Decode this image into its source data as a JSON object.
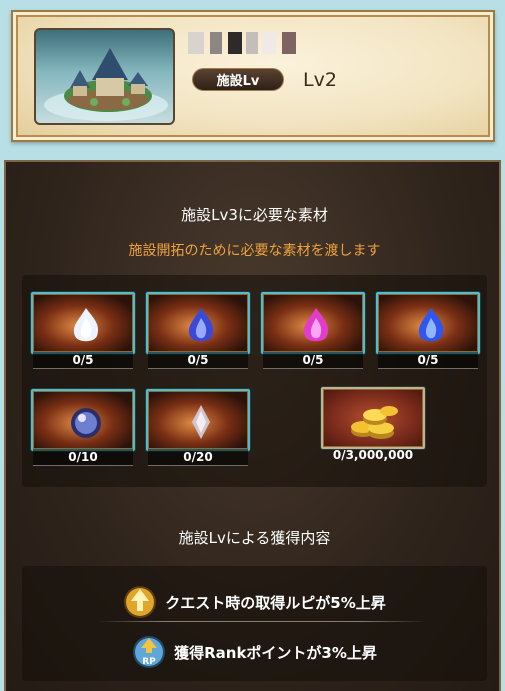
{
  "facility": {
    "level_badge": "施設Lv",
    "level_value": "Lv2",
    "thumbnail_icon": "island-facility-icon"
  },
  "requirements": {
    "title": "施設Lv3に必要な素材",
    "subtitle": "施設開拓のために必要な素材を渡します",
    "items": [
      {
        "icon": "white-flame-icon",
        "count": "0/5",
        "color": "#e8f2ff"
      },
      {
        "icon": "blue-flame-icon",
        "count": "0/5",
        "color": "#3a49d8"
      },
      {
        "icon": "pink-flame-icon",
        "count": "0/5",
        "color": "#e23ccb"
      },
      {
        "icon": "azure-flame-icon",
        "count": "0/5",
        "color": "#2f56f0"
      },
      {
        "icon": "crystal-orb-icon",
        "count": "0/10",
        "color": "#6f7fd0"
      },
      {
        "icon": "silver-shard-icon",
        "count": "0/20",
        "color": "#cfc6cf"
      },
      {
        "icon": "rupie-coins-icon",
        "count": "0/3,000,000",
        "color": "#f3c233"
      }
    ]
  },
  "rewards": {
    "title": "施設Lvによる獲得内容",
    "items": [
      {
        "icon": "rupie-boost-icon",
        "text": "クエスト時の取得ルピが5%上昇"
      },
      {
        "icon": "rank-point-icon",
        "text": "獲得Rankポイントが3%上昇"
      }
    ]
  }
}
